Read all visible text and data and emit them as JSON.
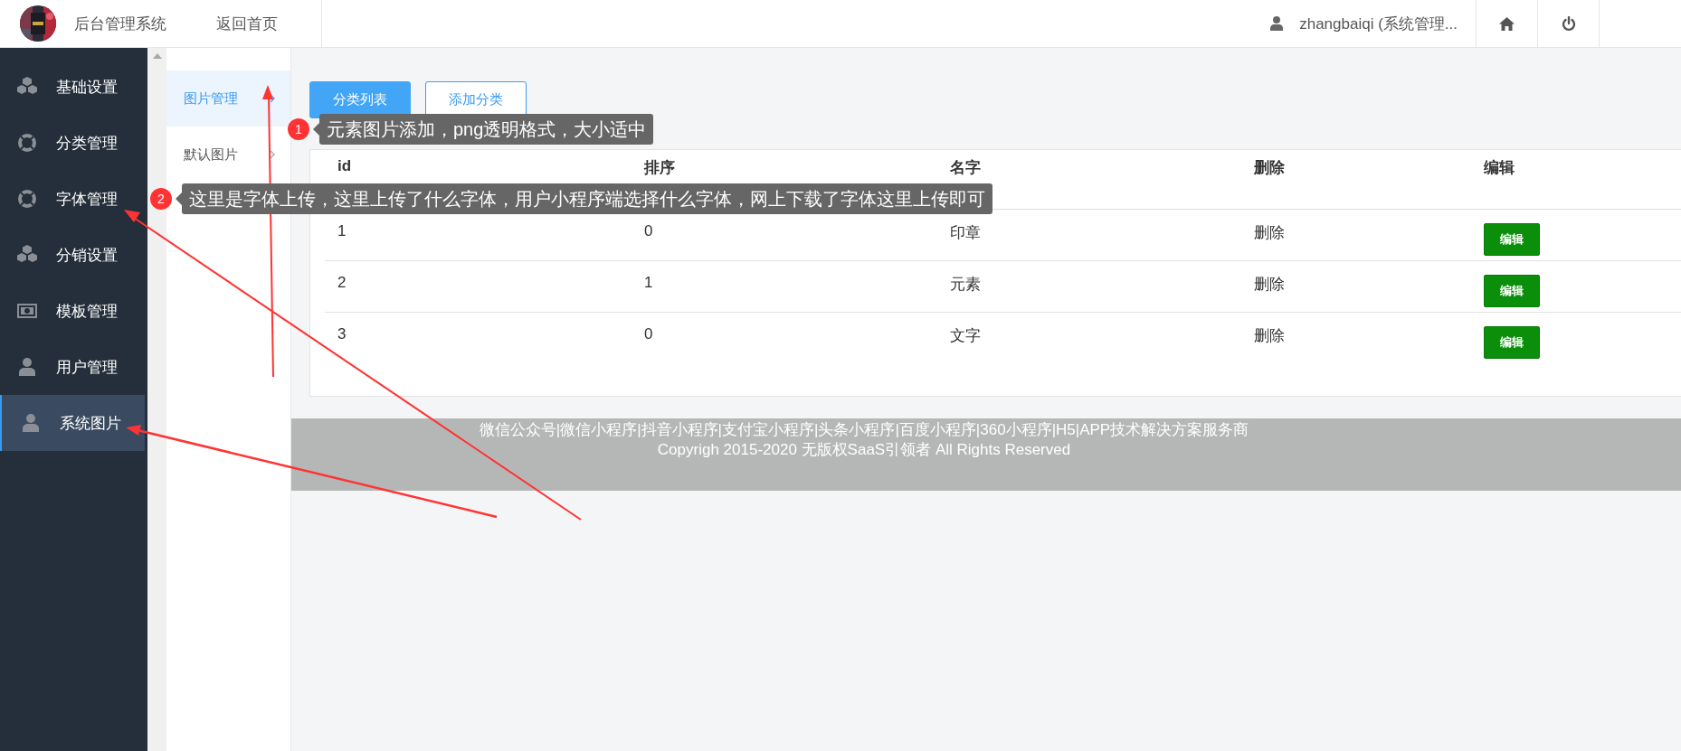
{
  "header": {
    "title": "后台管理系统",
    "home_link": "返回首页",
    "user": "zhangbaiqi (系统管理..."
  },
  "sidebar": {
    "items": [
      {
        "label": "基础设置",
        "kind": "cubes",
        "selected": false
      },
      {
        "label": "分类管理",
        "kind": "lifebuoy",
        "selected": false
      },
      {
        "label": "字体管理",
        "kind": "lifebuoy",
        "selected": false
      },
      {
        "label": "分销设置",
        "kind": "cubes",
        "selected": false
      },
      {
        "label": "模板管理",
        "kind": "money",
        "selected": false
      },
      {
        "label": "用户管理",
        "kind": "user",
        "selected": false
      },
      {
        "label": "系统图片",
        "kind": "user",
        "selected": true
      }
    ]
  },
  "subnav": {
    "items": [
      {
        "label": "图片管理",
        "selected": true
      },
      {
        "label": "默认图片",
        "selected": false
      }
    ]
  },
  "tabs": [
    {
      "label": "分类列表",
      "selected": true
    },
    {
      "label": "添加分类",
      "selected": false
    }
  ],
  "table": {
    "columns": [
      "id",
      "排序",
      "名字",
      "删除",
      "编辑"
    ],
    "rows": [
      {
        "id": "1",
        "order": "0",
        "name": "印章",
        "delete": "删除",
        "edit": "编辑"
      },
      {
        "id": "2",
        "order": "1",
        "name": "元素",
        "delete": "删除",
        "edit": "编辑"
      },
      {
        "id": "3",
        "order": "0",
        "name": "文字",
        "delete": "删除",
        "edit": "编辑"
      }
    ]
  },
  "footer": {
    "lines": [
      "微信公众号|微信小程序|抖音小程序|支付宝小程序|头条小程序|百度小程序|360小程序|H5|APP技术解决方案服务商",
      "Copyrigh 2015-2020 无版权SaaS引领者 All Rights Reserved"
    ]
  },
  "annotations": [
    {
      "number": "1",
      "text": "元素图片添加，png透明格式，大小适中"
    },
    {
      "number": "2",
      "text": "这里是字体上传，这里上传了什么字体，用户小程序端选择什么字体，网上下载了字体这里上传即可"
    }
  ]
}
